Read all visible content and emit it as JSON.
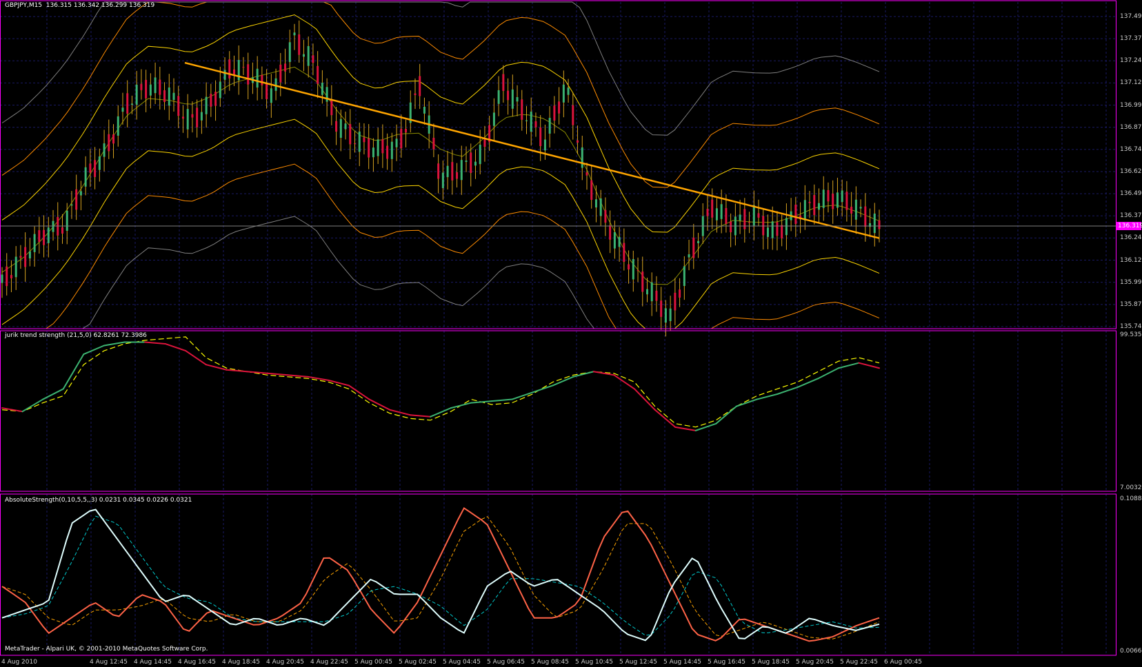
{
  "main": {
    "title": "GBPJPY,M15",
    "ohlc": "136.315 136.342 136.299 136.319",
    "price_tag": "136.319",
    "price_labels": [
      "137.495",
      "137.370",
      "137.245",
      "137.120",
      "136.995",
      "136.870",
      "136.745",
      "136.620",
      "136.495",
      "136.370",
      "136.245",
      "136.120",
      "135.995",
      "135.870",
      "135.745"
    ]
  },
  "jurik": {
    "title": "jurik trend strength (21,5,0) 62.8261 72.3986",
    "max": "99.5353",
    "min": "7.0032"
  },
  "absolute": {
    "title": "AbsoluteStrength(0,10,5,5,,3) 0.0231 0.0345 0.0226 0.0321",
    "max": "0.1088",
    "min": "0.0066"
  },
  "footer": {
    "copyright": "MetaTrader - Alpari UK, © 2001-2010 MetaQuotes Software Corp.",
    "time_labels": [
      "4 Aug 2010",
      "4 Aug 12:45",
      "4 Aug 14:45",
      "4 Aug 16:45",
      "4 Aug 18:45",
      "4 Aug 20:45",
      "4 Aug 22:45",
      "5 Aug 00:45",
      "5 Aug 02:45",
      "5 Aug 04:45",
      "5 Aug 06:45",
      "5 Aug 08:45",
      "5 Aug 10:45",
      "5 Aug 12:45",
      "5 Aug 14:45",
      "5 Aug 16:45",
      "5 Aug 18:45",
      "5 Aug 20:45",
      "5 Aug 22:45",
      "6 Aug 00:45"
    ]
  },
  "colors": {
    "background": "#000000",
    "grid": "#1a1a66",
    "frame": "#ff00ff",
    "bull": "#3cb371",
    "bear": "#dc143c",
    "wick": "#daa520",
    "trendline": "#ffa500",
    "band_center": "#8b8b00",
    "band_inner": "#ffd700",
    "band_mid": "#ff8c00",
    "band_outer": "#808080",
    "jurik_up": "#3cb371",
    "jurik_down": "#dc143c",
    "jurik_signal": "#ffff00",
    "abs_bull": "#ff6347",
    "abs_bear": "#e0ffff",
    "abs_bull_signal": "#ffa500",
    "abs_bear_signal": "#00ced1"
  },
  "chart_data": [
    {
      "type": "line",
      "title": "GBPJPY,M15",
      "ylim": [
        135.745,
        137.495
      ],
      "x_ticks": [
        "4 Aug 2010",
        "4 Aug 12:45",
        "4 Aug 14:45",
        "4 Aug 16:45",
        "4 Aug 18:45",
        "4 Aug 20:45",
        "4 Aug 22:45",
        "5 Aug 00:45",
        "5 Aug 02:45",
        "5 Aug 04:45",
        "5 Aug 06:45",
        "5 Aug 08:45",
        "5 Aug 10:45",
        "5 Aug 12:45",
        "5 Aug 14:45",
        "5 Aug 16:45",
        "5 Aug 18:45",
        "5 Aug 20:45",
        "5 Aug 22:45",
        "6 Aug 00:45"
      ],
      "close": [
        135.99,
        136.12,
        136.25,
        136.3,
        136.55,
        136.7,
        136.95,
        137.05,
        137.0,
        136.85,
        136.95,
        137.15,
        137.1,
        137.0,
        137.3,
        137.15,
        136.85,
        136.75,
        136.7,
        136.72,
        137.05,
        136.55,
        136.6,
        136.68,
        137.05,
        136.9,
        136.75,
        137.05,
        136.55,
        136.3,
        136.1,
        135.95,
        135.8,
        136.15,
        136.4,
        136.3,
        136.35,
        136.25,
        136.35,
        136.42,
        136.45,
        136.38,
        136.28
      ],
      "trendline": {
        "start": 137.17,
        "end": 136.23
      },
      "grid": true
    },
    {
      "type": "line",
      "title": "jurik trend strength (21,5,0)",
      "ylim": [
        7.0032,
        99.5353
      ],
      "series": [
        {
          "values": [
            54,
            53,
            58,
            62,
            80,
            88,
            92,
            94,
            95,
            96,
            84,
            78,
            76,
            74,
            73,
            72,
            70,
            66,
            58,
            52,
            49,
            48,
            53,
            60,
            57,
            58,
            63,
            70,
            74,
            76,
            75,
            70,
            56,
            46,
            44,
            48,
            56,
            62,
            66,
            70,
            76,
            82,
            84,
            81
          ]
        },
        {
          "values": [
            55,
            53,
            60,
            66,
            86,
            91,
            93,
            93,
            92,
            88,
            80,
            77,
            76,
            75,
            74,
            73,
            71,
            68,
            60,
            54,
            51,
            50,
            55,
            58,
            59,
            60,
            64,
            68,
            73,
            76,
            74,
            66,
            54,
            44,
            42,
            46,
            56,
            60,
            63,
            67,
            72,
            78,
            81,
            78
          ]
        }
      ]
    },
    {
      "type": "line",
      "title": "AbsoluteStrength(0,10,5,5,,3)",
      "ylim": [
        0.0066,
        0.1088
      ],
      "series": [
        {
          "values": [
            0.05,
            0.04,
            0.02,
            0.03,
            0.04,
            0.03,
            0.045,
            0.04,
            0.02,
            0.035,
            0.03,
            0.025,
            0.03,
            0.04,
            0.07,
            0.06,
            0.035,
            0.02,
            0.04,
            0.07,
            0.1,
            0.09,
            0.06,
            0.03,
            0.03,
            0.04,
            0.08,
            0.1,
            0.08,
            0.05,
            0.02,
            0.015,
            0.03,
            0.025,
            0.02,
            0.015,
            0.018,
            0.025,
            0.03
          ]
        },
        {
          "values": [
            0.03,
            0.035,
            0.04,
            0.09,
            0.1,
            0.08,
            0.06,
            0.04,
            0.045,
            0.035,
            0.025,
            0.03,
            0.025,
            0.03,
            0.025,
            0.04,
            0.055,
            0.045,
            0.045,
            0.03,
            0.02,
            0.05,
            0.06,
            0.05,
            0.055,
            0.045,
            0.035,
            0.02,
            0.015,
            0.05,
            0.07,
            0.04,
            0.015,
            0.025,
            0.02,
            0.03,
            0.025,
            0.022,
            0.026
          ]
        }
      ]
    }
  ]
}
